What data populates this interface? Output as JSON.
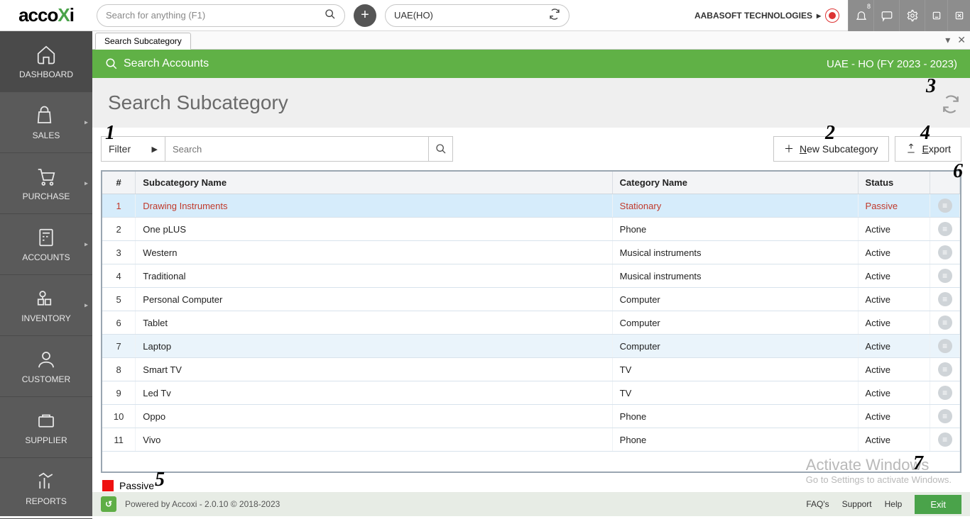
{
  "top": {
    "search_placeholder": "Search for anything (F1)",
    "branch": "UAE(HO)",
    "company": "AABASOFT TECHNOLOGIES",
    "notif_badge": "8"
  },
  "sidebar": {
    "items": [
      {
        "label": "DASHBOARD"
      },
      {
        "label": "SALES"
      },
      {
        "label": "PURCHASE"
      },
      {
        "label": "ACCOUNTS"
      },
      {
        "label": "INVENTORY"
      },
      {
        "label": "CUSTOMER"
      },
      {
        "label": "SUPPLIER"
      },
      {
        "label": "REPORTS"
      }
    ]
  },
  "tab": {
    "label": "Search Subcategory"
  },
  "greenbar": {
    "left": "Search Accounts",
    "right": "UAE - HO (FY 2023 - 2023)"
  },
  "page": {
    "title": "Search Subcategory"
  },
  "filter": {
    "label": "Filter",
    "placeholder": "Search"
  },
  "buttons": {
    "new_prefix": "N",
    "new_rest": "ew Subcategory",
    "exp_prefix": "E",
    "exp_rest": "xport"
  },
  "table": {
    "headers": {
      "num": "#",
      "sub": "Subcategory Name",
      "cat": "Category Name",
      "status": "Status"
    },
    "rows": [
      {
        "n": "1",
        "sub": "Drawing Instruments",
        "cat": "Stationary",
        "status": "Passive",
        "passive": true,
        "sel": true
      },
      {
        "n": "2",
        "sub": "One pLUS",
        "cat": "Phone",
        "status": "Active"
      },
      {
        "n": "3",
        "sub": "Western",
        "cat": "Musical instruments",
        "status": "Active"
      },
      {
        "n": "4",
        "sub": "Traditional",
        "cat": "Musical instruments",
        "status": "Active"
      },
      {
        "n": "5",
        "sub": "Personal Computer",
        "cat": "Computer",
        "status": "Active"
      },
      {
        "n": "6",
        "sub": "Tablet",
        "cat": "Computer",
        "status": "Active"
      },
      {
        "n": "7",
        "sub": "Laptop",
        "cat": "Computer",
        "status": "Active",
        "hover": true
      },
      {
        "n": "8",
        "sub": "Smart TV",
        "cat": "TV",
        "status": "Active"
      },
      {
        "n": "9",
        "sub": "Led Tv",
        "cat": "TV",
        "status": "Active"
      },
      {
        "n": "10",
        "sub": "Oppo",
        "cat": "Phone",
        "status": "Active"
      },
      {
        "n": "11",
        "sub": "Vivo",
        "cat": "Phone",
        "status": "Active"
      }
    ]
  },
  "legend": {
    "label": "Passive"
  },
  "annotations": {
    "a1": "1",
    "a2": "2",
    "a3": "3",
    "a4": "4",
    "a5": "5",
    "a6": "6",
    "a7": "7"
  },
  "watermark": {
    "title": "Activate Windows",
    "sub": "Go to Settings to activate Windows."
  },
  "footer": {
    "powered": "Powered by Accoxi - 2.0.10 © 2018-2023",
    "faq": "FAQ's",
    "support": "Support",
    "help": "Help",
    "exit": "Exit"
  }
}
